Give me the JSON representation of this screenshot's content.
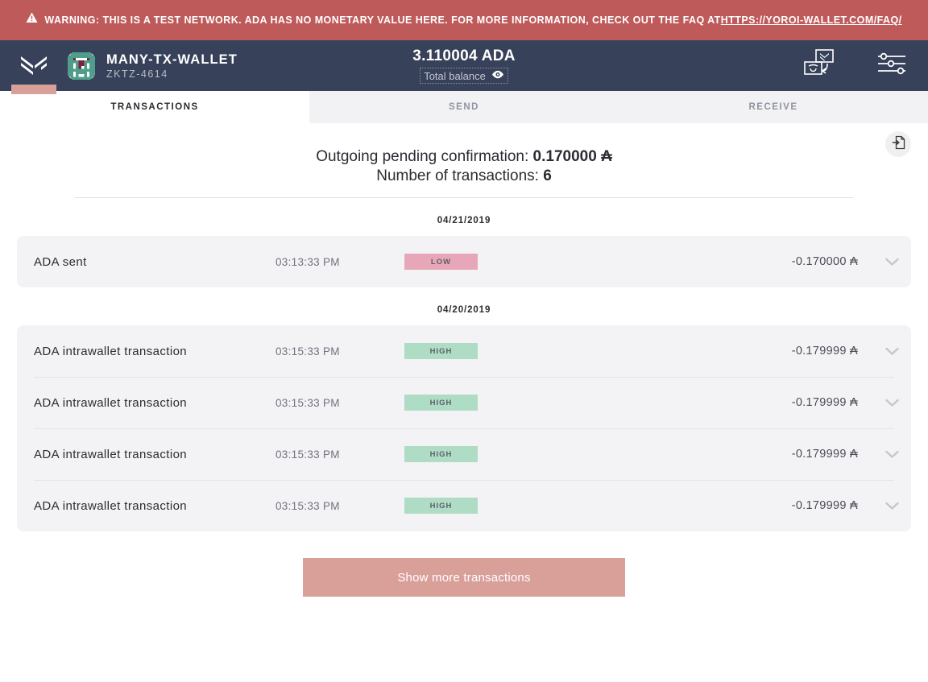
{
  "banner": {
    "icon": "warning-triangle-icon",
    "text_before": "WARNING: THIS IS A TEST NETWORK. ADA HAS NO MONETARY VALUE HERE. FOR MORE INFORMATION, CHECK OUT THE FAQ AT ",
    "link_text": "HTTPS://YOROI-WALLET.COM/FAQ/",
    "bg_color": "#BF5A5A"
  },
  "navbar": {
    "logo": "yoroi-logo-icon",
    "wallet_name": "MANY-TX-WALLET",
    "wallet_id": "ZKTZ-4614",
    "balance_amount": "3.110004 ADA",
    "balance_label": "Total balance",
    "balance_eye_icon": "eye-icon",
    "switch_wallet_icon": "switch-wallet-icon",
    "settings_icon": "settings-sliders-icon",
    "bg_color": "#38415A",
    "accent_color": "#D9A09A"
  },
  "tabs": [
    {
      "label": "TRANSACTIONS",
      "active": true
    },
    {
      "label": "SEND",
      "active": false
    },
    {
      "label": "RECEIVE",
      "active": false
    }
  ],
  "summary": {
    "pending_label": "Outgoing pending confirmation:",
    "pending_value": "0.170000 ₳",
    "count_label": "Number of transactions:",
    "count_value": "6",
    "export_icon": "export-file-icon"
  },
  "groups": [
    {
      "date": "04/21/2019",
      "rows": [
        {
          "type": "ADA sent",
          "time": "03:13:33 PM",
          "badge": "LOW",
          "badge_level": "low",
          "amount": "-0.170000 ₳",
          "chevron": "chevron-down-icon"
        }
      ]
    },
    {
      "date": "04/20/2019",
      "rows": [
        {
          "type": "ADA intrawallet transaction",
          "time": "03:15:33 PM",
          "badge": "HIGH",
          "badge_level": "high",
          "amount": "-0.179999 ₳",
          "chevron": "chevron-down-icon"
        },
        {
          "type": "ADA intrawallet transaction",
          "time": "03:15:33 PM",
          "badge": "HIGH",
          "badge_level": "high",
          "amount": "-0.179999 ₳",
          "chevron": "chevron-down-icon"
        },
        {
          "type": "ADA intrawallet transaction",
          "time": "03:15:33 PM",
          "badge": "HIGH",
          "badge_level": "high",
          "amount": "-0.179999 ₳",
          "chevron": "chevron-down-icon"
        },
        {
          "type": "ADA intrawallet transaction",
          "time": "03:15:33 PM",
          "badge": "HIGH",
          "badge_level": "high",
          "amount": "-0.179999 ₳",
          "chevron": "chevron-down-icon"
        }
      ]
    }
  ],
  "footer": {
    "show_more_label": "Show more transactions",
    "show_more_color": "#D9A09A"
  },
  "badge_colors": {
    "low_bg": "#E8A7B8",
    "high_bg": "#AFDCC4",
    "text": "#5C5F6B"
  }
}
